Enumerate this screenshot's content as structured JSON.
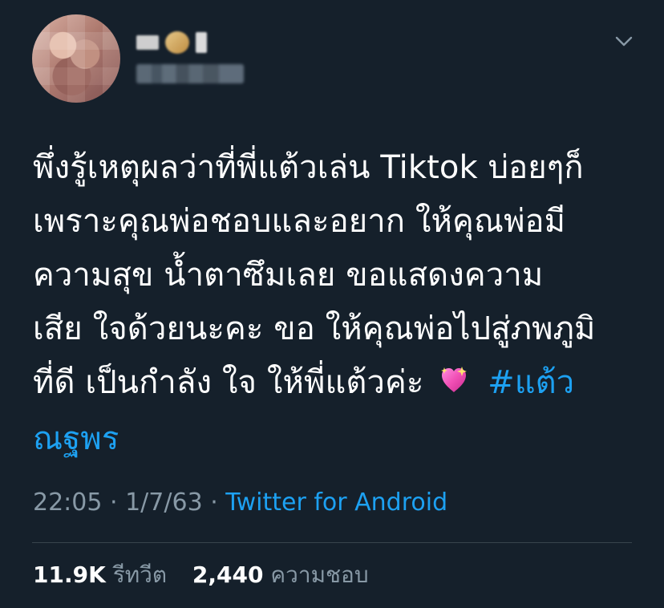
{
  "tweet": {
    "user": {
      "display_name": "",
      "handle": ""
    },
    "text_lines": [
      "พึ่งรู้เหตุผลว่าที่พี่แต้วเล่น Tiktok บ่อยๆก็",
      "เพราะคุณพ่อชอบและอยาก ให้คุณพ่อมี",
      "ความสุข น้ำตาซึมเลย ขอแสดงความ",
      "เสีย ใจด้วยนะคะ ขอ ให้คุณพ่อไปสู่ภพภูมิ",
      "ที่ดี เป็นกำลัง ใจ ให้พี่แต้วค่ะ"
    ],
    "hashtag_line_1": "#แต้ว",
    "hashtag_line_2": "ณฐพร",
    "emoji_icon": "sparkling-heart-icon",
    "time": "22:05",
    "date": "1/7/63",
    "source": "Twitter for Android",
    "retweets_count": "11.9K",
    "retweets_label": "รีทวีต",
    "likes_count": "2,440",
    "likes_label": "ความชอบ"
  },
  "colors": {
    "background": "#15202b",
    "text": "#ffffff",
    "muted": "#8899a6",
    "accent": "#1da1f2",
    "divider": "#38444d"
  }
}
